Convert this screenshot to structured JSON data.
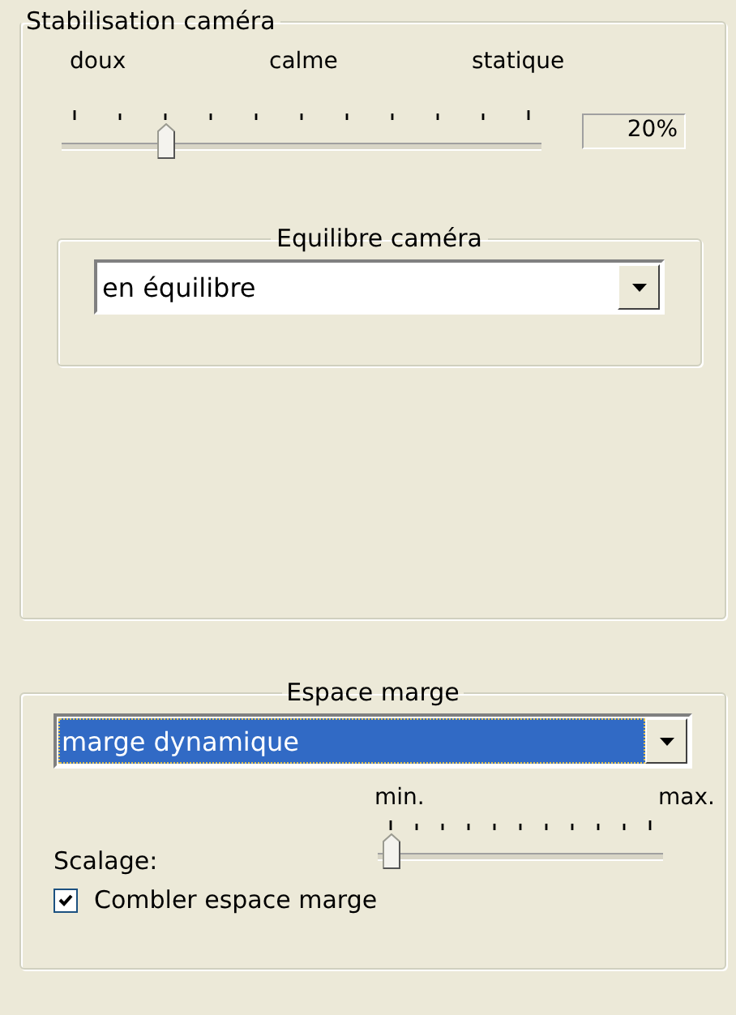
{
  "stabilisation": {
    "title": "Stabilisation caméra",
    "scale_labels": [
      "doux",
      "calme",
      "statique"
    ],
    "slider": {
      "level": 0.2
    },
    "reading": "20%",
    "equilibre": {
      "title": "Equilibre caméra",
      "dropdown": {
        "value": "en équilibre",
        "selected": false
      }
    }
  },
  "espace_marge": {
    "title": "Espace marge",
    "dropdown": {
      "value": "marge dynamique",
      "selected": true
    },
    "scale_labels": [
      "min.",
      "max."
    ],
    "label": "Scalage:",
    "slider": {
      "level": 0
    },
    "checkbox": {
      "label": "Combler espace marge",
      "checked": true
    }
  }
}
